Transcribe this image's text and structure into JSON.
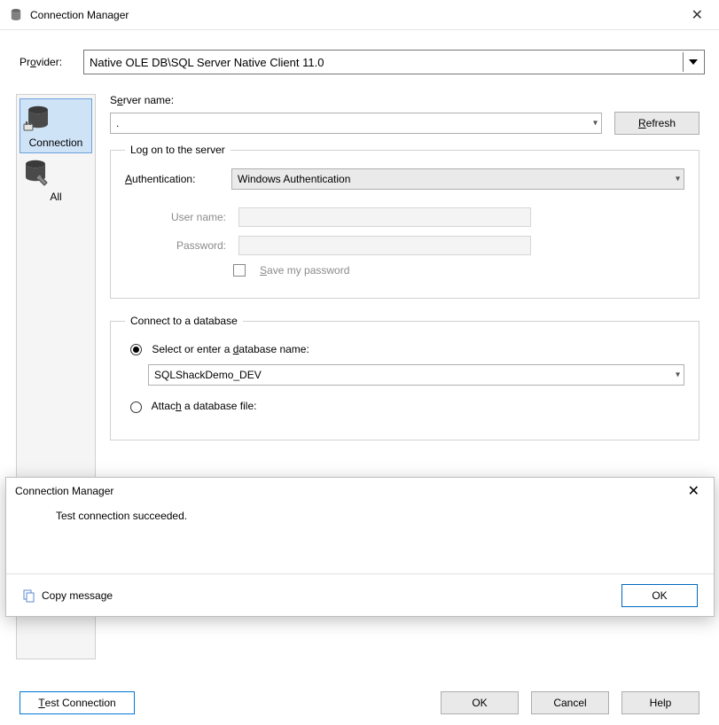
{
  "window": {
    "title": "Connection Manager",
    "close_label": "✕"
  },
  "provider": {
    "label": "Provider:",
    "value": "Native OLE DB\\SQL Server Native Client 11.0"
  },
  "nav": {
    "items": [
      {
        "label": "Connection"
      },
      {
        "label": "All"
      }
    ]
  },
  "server": {
    "label": "Server name:",
    "value": ".",
    "refresh_label": "Refresh"
  },
  "logon": {
    "legend": "Log on to the server",
    "auth_label": "Authentication:",
    "auth_value": "Windows Authentication",
    "user_label": "User name:",
    "pass_label": "Password:",
    "save_pw_label": "Save my password"
  },
  "db": {
    "legend": "Connect to a database",
    "opt1_label": "Select or enter a database name:",
    "opt1_value": "SQLShackDemo_DEV",
    "opt2_label": "Attach a database file:"
  },
  "footer": {
    "test_label": "Test Connection",
    "ok_label": "OK",
    "cancel_label": "Cancel",
    "help_label": "Help"
  },
  "popup": {
    "title": "Connection Manager",
    "message": "Test connection succeeded.",
    "copy_label": "Copy message",
    "ok_label": "OK"
  }
}
